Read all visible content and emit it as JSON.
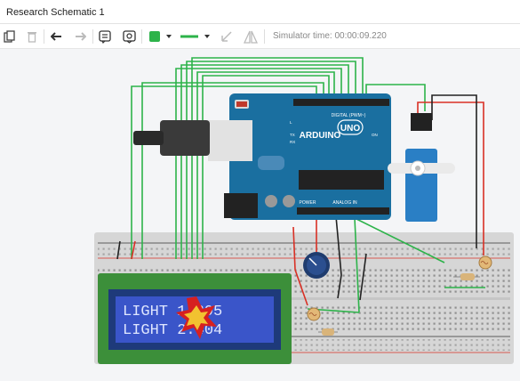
{
  "window": {
    "title": "Research Schematic 1"
  },
  "toolbar": {
    "simulator_label": "Simulator time: 00:00:09.220",
    "fill_color": "#2db34a",
    "line_color": "#2db34a",
    "tools": [
      {
        "name": "copy-icon"
      },
      {
        "name": "delete-icon"
      },
      {
        "name": "undo-icon"
      },
      {
        "name": "redo-icon"
      },
      {
        "name": "notes-icon"
      },
      {
        "name": "view-toggle-icon"
      },
      {
        "name": "fill-color-picker"
      },
      {
        "name": "line-style-picker"
      },
      {
        "name": "rotate-icon"
      },
      {
        "name": "mirror-icon"
      }
    ]
  },
  "arduino": {
    "brand": "ARDUINO",
    "model": "UNO",
    "header_digital": "DIGITAL (PWM~)",
    "header_analog": "ANALOG IN",
    "header_power": "POWER",
    "label_tx": "TX",
    "label_rx": "RX",
    "label_on": "ON",
    "label_l": "L"
  },
  "lcd": {
    "line1": "LIGHT  1:395",
    "line2": "LIGHT  2:404",
    "backlight_color": "#3a55c9",
    "text_color": "#dfe6ff"
  },
  "colors": {
    "wire_green": "#2db34a",
    "wire_red": "#d93025",
    "wire_black": "#222222",
    "board_blue": "#1a6fa0",
    "servo_blue": "#2a7fc5",
    "breadboard": "#d8d8d8"
  }
}
